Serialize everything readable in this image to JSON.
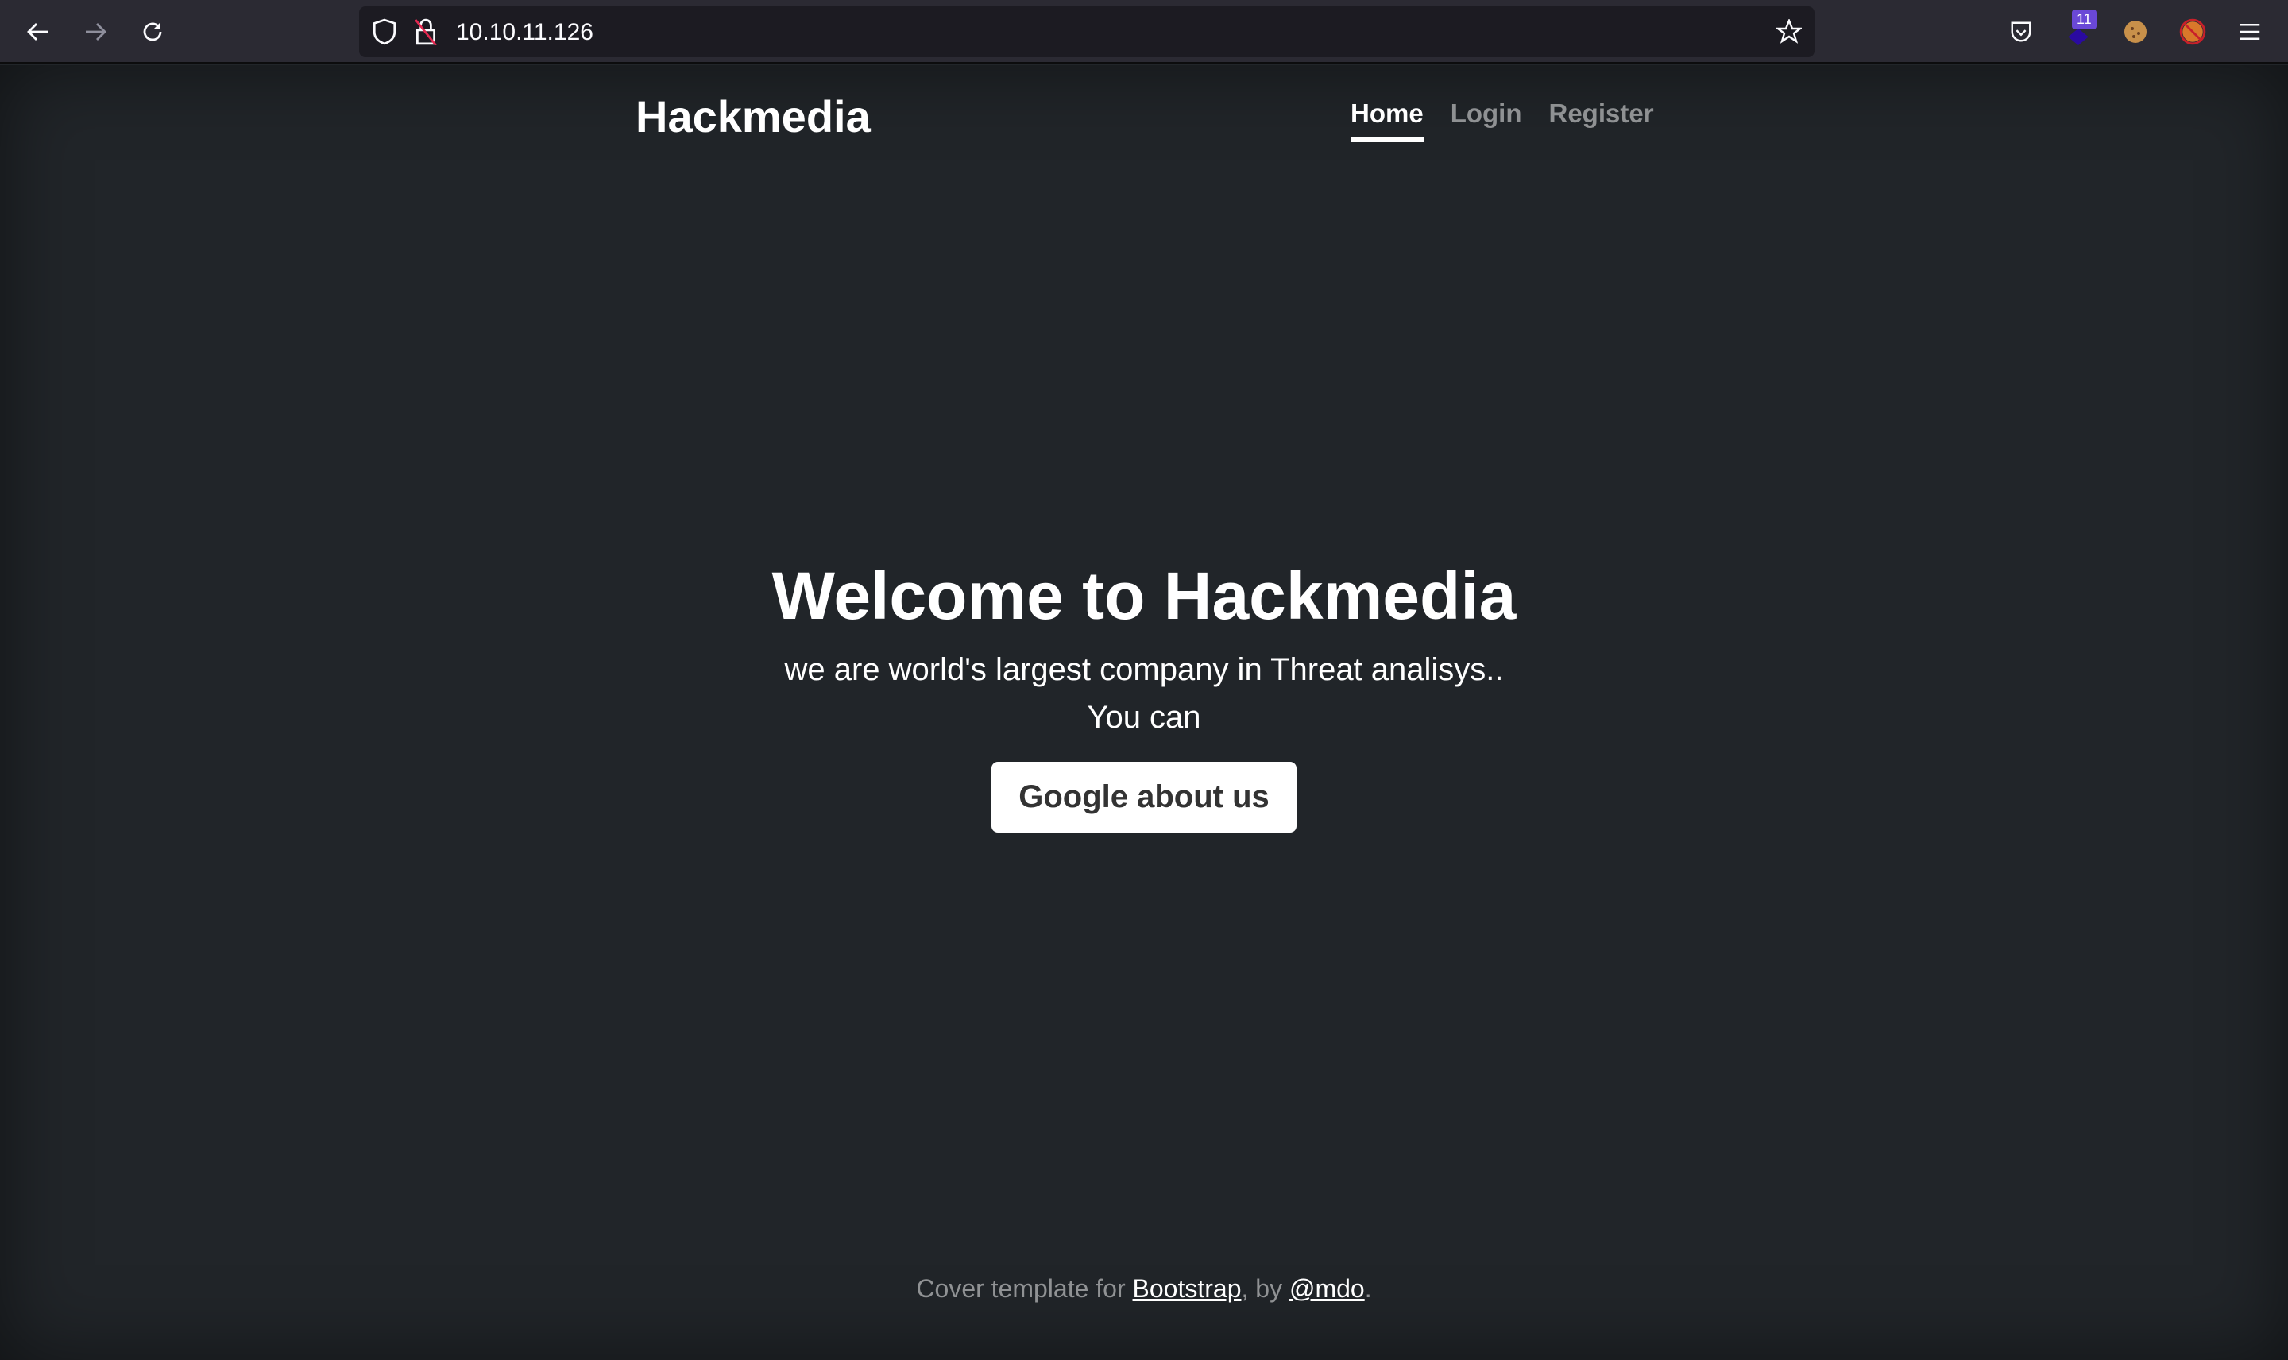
{
  "browser": {
    "url": "10.10.11.126",
    "extension_badge": "11"
  },
  "site": {
    "brand": "Hackmedia",
    "nav": [
      {
        "label": "Home",
        "active": true
      },
      {
        "label": "Login"
      },
      {
        "label": "Register"
      }
    ],
    "heading": "Welcome to Hackmedia",
    "lead_line1": "we are world's largest company in Threat analisys..",
    "lead_line2": "You can",
    "cta": "Google about us",
    "footer": {
      "prefix": "Cover template for ",
      "link1": "Bootstrap",
      "mid": ", by ",
      "link2": "@mdo",
      "suffix": "."
    }
  }
}
